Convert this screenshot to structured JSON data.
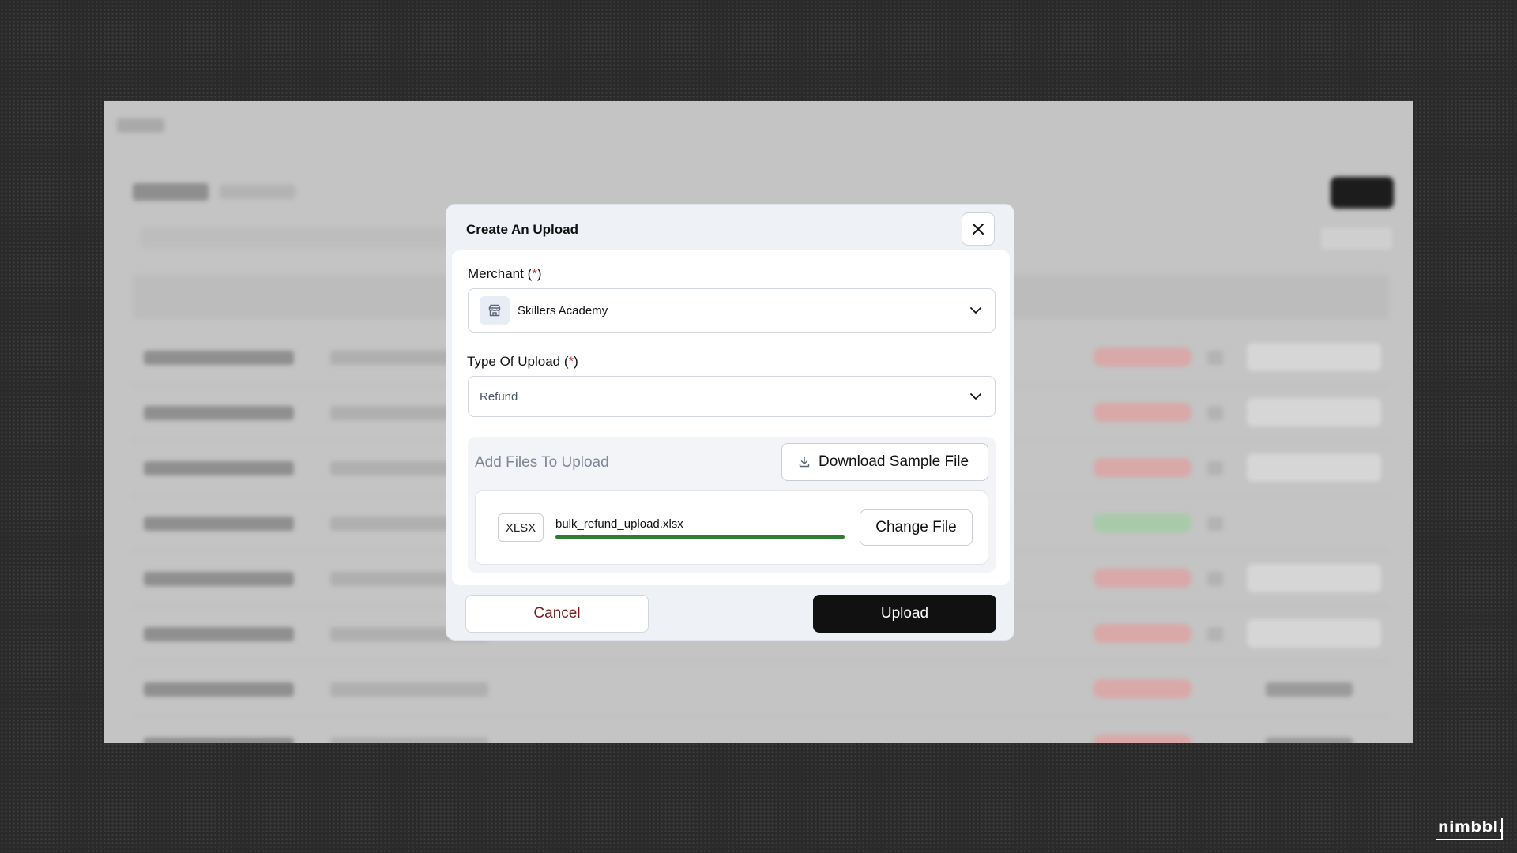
{
  "modal": {
    "title": "Create An Upload",
    "merchant_label": "Merchant",
    "merchant_req_open": " (",
    "merchant_req_star": "*",
    "merchant_req_close": ")",
    "merchant_value": "Skillers Academy",
    "type_label": "Type Of Upload",
    "type_req_open": " (",
    "type_req_star": "*",
    "type_req_close": ")",
    "type_value": "Refund",
    "upload_area_label": "Add Files To Upload",
    "download_sample_label": "Download Sample File",
    "file": {
      "type_badge": "XLSX",
      "name": "bulk_refund_upload.xlsx",
      "progress_percent": 100
    },
    "change_file_label": "Change File",
    "cancel_label": "Cancel",
    "upload_label": "Upload"
  },
  "brand": {
    "logo_text": "nimbbl."
  },
  "colors": {
    "required_mark": "#c0392b",
    "progress": "#2e7d32",
    "primary_button": "#111111",
    "cancel_text": "#7a1c1c"
  },
  "icons": [
    "close-icon",
    "store-icon",
    "chevron-down-icon",
    "download-icon"
  ]
}
